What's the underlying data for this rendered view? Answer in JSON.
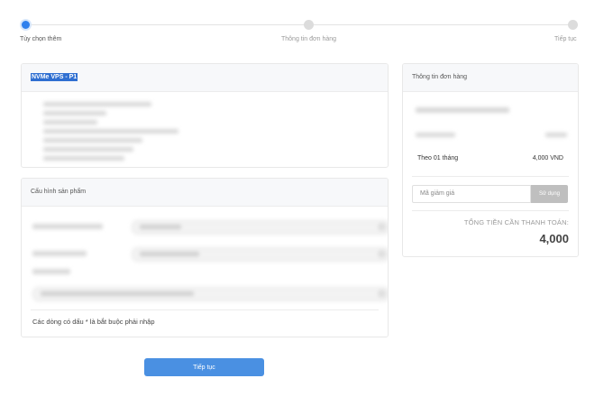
{
  "stepper": {
    "steps": [
      {
        "label": "Tùy chọn thêm",
        "active": true
      },
      {
        "label": "Thông tin đơn hàng",
        "active": false
      },
      {
        "label": "Tiếp tục",
        "active": false
      }
    ]
  },
  "product": {
    "title": "NVMe VPS - P1"
  },
  "config": {
    "title": "Cấu hình sản phẩm",
    "required_note": "Các dòng có dấu * là bắt buộc phải nhập"
  },
  "order": {
    "title": "Thông tin đơn hàng",
    "billing_label": "Theo 01 tháng",
    "billing_value": "4,000 VND",
    "coupon_placeholder": "Mã giảm giá",
    "coupon_button": "Sử dụng",
    "total_label": "TỔNG TIỀN CẦN THANH TOÁN:",
    "total_value": "4,000"
  },
  "actions": {
    "continue_label": "Tiếp tục"
  },
  "colors": {
    "accent": "#4a90e2",
    "step_active": "#2f80ed",
    "highlight": "#2f6fd1"
  }
}
